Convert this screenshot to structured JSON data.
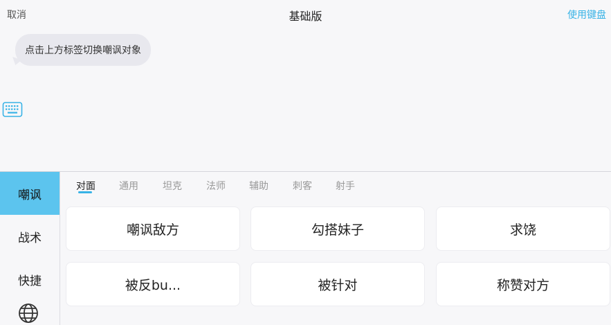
{
  "header": {
    "cancel_label": "取消",
    "title": "基础版",
    "keyboard_label": "使用键盘"
  },
  "chat": {
    "bubble_text": "点击上方标签切换嘲讽对象"
  },
  "sidebar": {
    "items": [
      {
        "label": "嘲讽",
        "active": true
      },
      {
        "label": "战术",
        "active": false
      },
      {
        "label": "快捷",
        "active": false
      }
    ]
  },
  "tabs": [
    {
      "label": "对面",
      "active": true
    },
    {
      "label": "通用",
      "active": false
    },
    {
      "label": "坦克",
      "active": false
    },
    {
      "label": "法师",
      "active": false
    },
    {
      "label": "辅助",
      "active": false
    },
    {
      "label": "刺客",
      "active": false
    },
    {
      "label": "射手",
      "active": false
    }
  ],
  "phrases": [
    {
      "label": "嘲讽敌方"
    },
    {
      "label": "勾搭妹子"
    },
    {
      "label": "求饶"
    },
    {
      "label": "被反bu..."
    },
    {
      "label": "被针对"
    },
    {
      "label": "称赞对方"
    }
  ],
  "colors": {
    "accent": "#38b3e6",
    "sidebar_active": "#5cc4ee",
    "background": "#f7f7f9"
  },
  "icons": {
    "keyboard": "keyboard-icon",
    "globe": "globe-icon"
  }
}
